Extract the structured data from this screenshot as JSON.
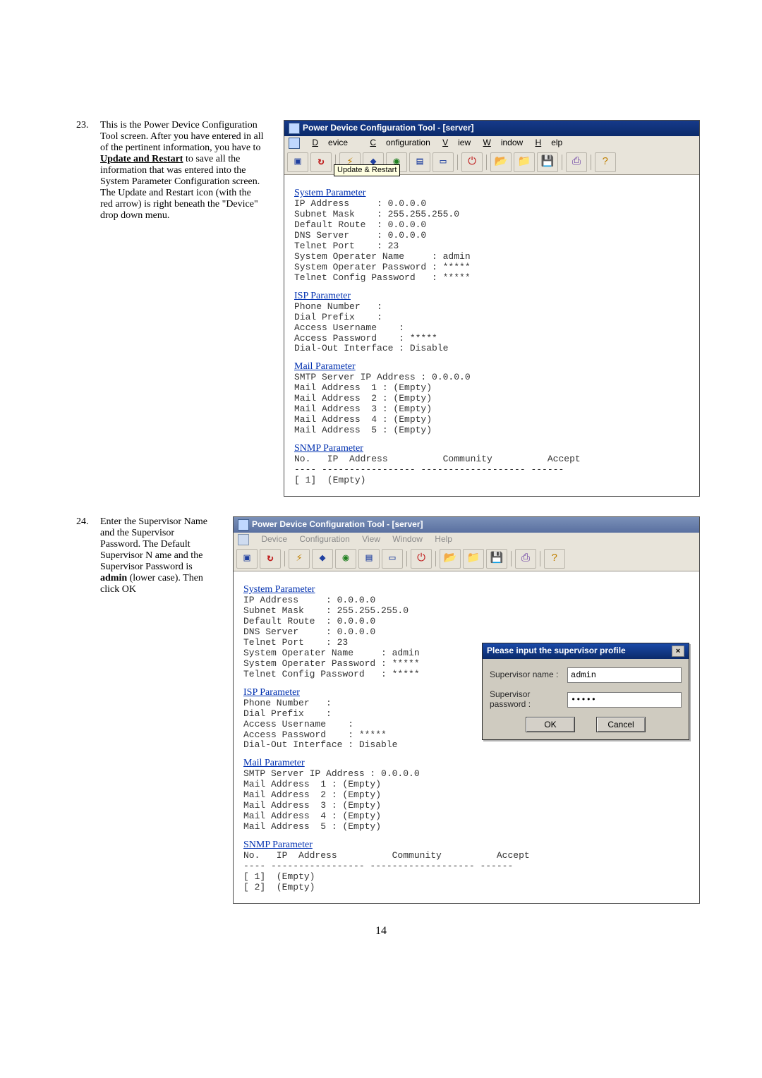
{
  "page_number": "14",
  "step23": {
    "number": "23.",
    "text_before": "This is the Power Device Configuration Tool screen.  After you have entered in all of the pertinent information, you have to ",
    "link": "Update and Restart",
    "text_after": " to save all the information that was entered into the System Parameter Configuration screen.  The Update and Restart icon (with the red arrow) is right beneath the \"Device\" drop down menu."
  },
  "step24": {
    "number": "24.",
    "text_before": "Enter the Supervisor Name and the Supervisor Password. The Default Supervisor N ame and the Supervisor Password is ",
    "bold": "admin",
    "text_after": " (lower case). Then click OK"
  },
  "win_common": {
    "title": "Power Device Configuration Tool - [server]",
    "menu": {
      "device": "Device",
      "config": "Configuration",
      "view": "View",
      "window": "Window",
      "help": "Help"
    },
    "tooltip": "Update & Restart",
    "system_header": "System Parameter",
    "system": [
      "IP Address     : 0.0.0.0",
      "Subnet Mask    : 255.255.255.0",
      "Default Route  : 0.0.0.0",
      "DNS Server     : 0.0.0.0",
      "Telnet Port    : 23",
      "System Operater Name     : admin",
      "System Operater Password : *****",
      "Telnet Config Password   : *****"
    ],
    "isp_header": "ISP Parameter",
    "isp": [
      "Phone Number   :",
      "Dial Prefix    :",
      "Access Username    :",
      "Access Password    : *****",
      "Dial-Out Interface : Disable"
    ],
    "mail_header": "Mail Parameter",
    "mail": [
      "SMTP Server IP Address : 0.0.0.0",
      "Mail Address  1 : (Empty)",
      "Mail Address  2 : (Empty)",
      "Mail Address  3 : (Empty)",
      "Mail Address  4 : (Empty)",
      "Mail Address  5 : (Empty)"
    ],
    "snmp_header": "SNMP Parameter",
    "snmp_cols": "No.   IP  Address          Community          Accept",
    "snmp_divider": "---- ----------------- ------------------- ------",
    "snmp_row1": "[ 1]  (Empty)",
    "snmp_row2": "[ 2]  (Empty)"
  },
  "dialog": {
    "title": "Please input the supervisor profile",
    "name_label": "Supervisor name :",
    "pass_label": "Supervisor password :",
    "name_value": "admin",
    "pass_value": "•••••",
    "ok": "OK",
    "cancel": "Cancel"
  }
}
